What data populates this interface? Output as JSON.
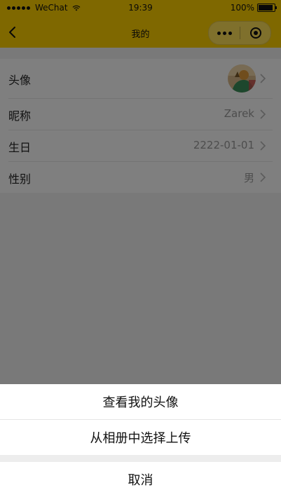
{
  "status_bar": {
    "carrier": "WeChat",
    "time": "19:39",
    "battery": "100%"
  },
  "nav": {
    "title": "我的"
  },
  "profile": {
    "avatar_label": "头像",
    "nickname_label": "昵称",
    "nickname_value": "Zarek",
    "birthday_label": "生日",
    "birthday_value": "2222-01-01",
    "gender_label": "性别",
    "gender_value": "男"
  },
  "action_sheet": {
    "options": [
      "查看我的头像",
      "从相册中选择上传"
    ],
    "cancel": "取消"
  },
  "colors": {
    "accent": "#FFD000",
    "overlay": "rgba(0,0,0,0.5)"
  },
  "icons": [
    "back-icon",
    "more-icon",
    "close-target-icon",
    "chevron-right-icon",
    "wifi-icon",
    "battery-icon"
  ]
}
